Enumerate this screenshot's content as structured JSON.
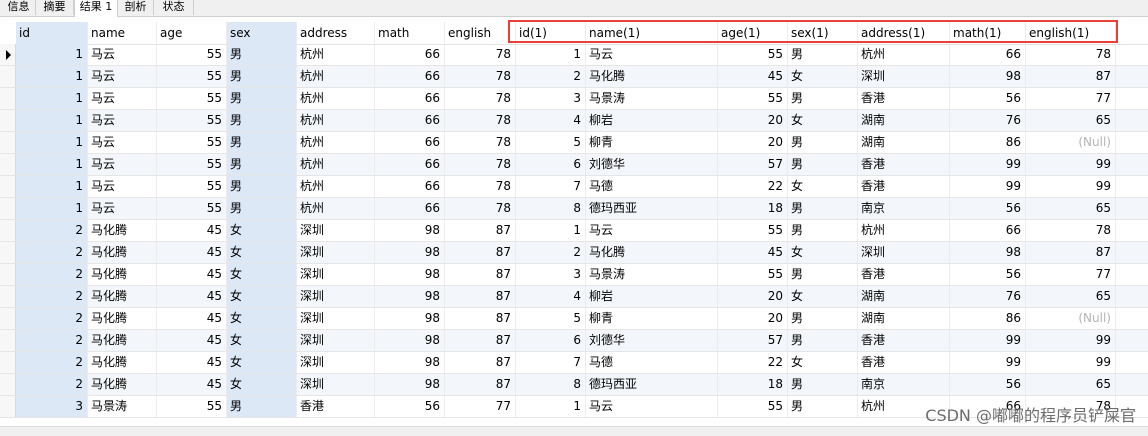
{
  "tabs": [
    "信息",
    "摘要",
    "结果 1",
    "剖析",
    "状态"
  ],
  "columns": [
    "id",
    "name",
    "age",
    "sex",
    "address",
    "math",
    "english",
    "id(1)",
    "name(1)",
    "age(1)",
    "sex(1)",
    "address(1)",
    "math(1)",
    "english(1)"
  ],
  "rows": [
    [
      "1",
      "马云",
      "55",
      "男",
      "杭州",
      "66",
      "78",
      "1",
      "马云",
      "55",
      "男",
      "杭州",
      "66",
      "78"
    ],
    [
      "1",
      "马云",
      "55",
      "男",
      "杭州",
      "66",
      "78",
      "2",
      "马化腾",
      "45",
      "女",
      "深圳",
      "98",
      "87"
    ],
    [
      "1",
      "马云",
      "55",
      "男",
      "杭州",
      "66",
      "78",
      "3",
      "马景涛",
      "55",
      "男",
      "香港",
      "56",
      "77"
    ],
    [
      "1",
      "马云",
      "55",
      "男",
      "杭州",
      "66",
      "78",
      "4",
      "柳岩",
      "20",
      "女",
      "湖南",
      "76",
      "65"
    ],
    [
      "1",
      "马云",
      "55",
      "男",
      "杭州",
      "66",
      "78",
      "5",
      "柳青",
      "20",
      "男",
      "湖南",
      "86",
      "(Null)"
    ],
    [
      "1",
      "马云",
      "55",
      "男",
      "杭州",
      "66",
      "78",
      "6",
      "刘德华",
      "57",
      "男",
      "香港",
      "99",
      "99"
    ],
    [
      "1",
      "马云",
      "55",
      "男",
      "杭州",
      "66",
      "78",
      "7",
      "马德",
      "22",
      "女",
      "香港",
      "99",
      "99"
    ],
    [
      "1",
      "马云",
      "55",
      "男",
      "杭州",
      "66",
      "78",
      "8",
      "德玛西亚",
      "18",
      "男",
      "南京",
      "56",
      "65"
    ],
    [
      "2",
      "马化腾",
      "45",
      "女",
      "深圳",
      "98",
      "87",
      "1",
      "马云",
      "55",
      "男",
      "杭州",
      "66",
      "78"
    ],
    [
      "2",
      "马化腾",
      "45",
      "女",
      "深圳",
      "98",
      "87",
      "2",
      "马化腾",
      "45",
      "女",
      "深圳",
      "98",
      "87"
    ],
    [
      "2",
      "马化腾",
      "45",
      "女",
      "深圳",
      "98",
      "87",
      "3",
      "马景涛",
      "55",
      "男",
      "香港",
      "56",
      "77"
    ],
    [
      "2",
      "马化腾",
      "45",
      "女",
      "深圳",
      "98",
      "87",
      "4",
      "柳岩",
      "20",
      "女",
      "湖南",
      "76",
      "65"
    ],
    [
      "2",
      "马化腾",
      "45",
      "女",
      "深圳",
      "98",
      "87",
      "5",
      "柳青",
      "20",
      "男",
      "湖南",
      "86",
      "(Null)"
    ],
    [
      "2",
      "马化腾",
      "45",
      "女",
      "深圳",
      "98",
      "87",
      "6",
      "刘德华",
      "57",
      "男",
      "香港",
      "99",
      "99"
    ],
    [
      "2",
      "马化腾",
      "45",
      "女",
      "深圳",
      "98",
      "87",
      "7",
      "马德",
      "22",
      "女",
      "香港",
      "99",
      "99"
    ],
    [
      "2",
      "马化腾",
      "45",
      "女",
      "深圳",
      "98",
      "87",
      "8",
      "德玛西亚",
      "18",
      "男",
      "南京",
      "56",
      "65"
    ],
    [
      "3",
      "马景涛",
      "55",
      "男",
      "香港",
      "56",
      "77",
      "1",
      "马云",
      "55",
      "男",
      "杭州",
      "66",
      "78"
    ]
  ],
  "watermark": "CSDN @嘟嘟的程序员铲屎官",
  "colors": {
    "selected_column": "#dde8f7",
    "highlight_box": "#e8413a",
    "alt_row": "#f3f7fb"
  }
}
